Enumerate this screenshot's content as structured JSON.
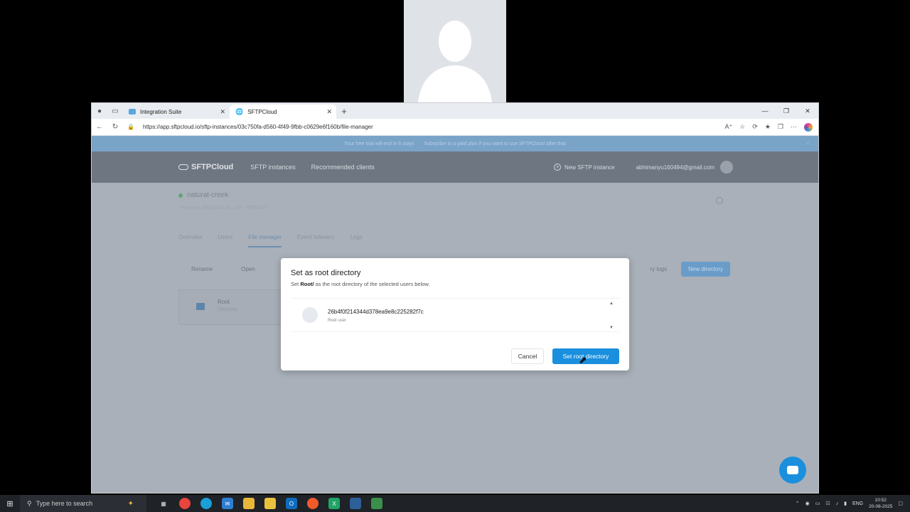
{
  "browser": {
    "tabs": [
      {
        "label": "Integration Suite",
        "active": false
      },
      {
        "label": "SFTPCloud",
        "active": true
      }
    ],
    "url": "https://app.sftpcloud.io/sftp-instances/03c750fa-d560-4f49-9fbb-c0629e6f160b/file-manager"
  },
  "banner": {
    "trial_text": "Your free trial will end in 6 stays",
    "cta_text": "Subscribe to a paid plan if you want to use SFTPCloud after that"
  },
  "nav": {
    "logo": "SFTPCloud",
    "links": [
      "SFTP instances",
      "Recommended clients"
    ],
    "new_instance": "New SFTP instance",
    "email": "abhimanyu160494@gmail.com"
  },
  "instance": {
    "name": "natural-creek",
    "meta": "eu-west.sftpcloud.io   ·   ctx   ·   STRUCT"
  },
  "subnav": [
    "Overview",
    "Users",
    "File manager",
    "Event listeners",
    "Logs"
  ],
  "toolbar": {
    "rename": "Rename",
    "open": "Open",
    "logs": "ry logs",
    "new_directory": "New directory"
  },
  "folder": {
    "name": "Root",
    "type": "Directory"
  },
  "modal": {
    "title": "Set as root directory",
    "sub_prefix": "Set ",
    "sub_path": "Root/",
    "sub_suffix": " as the root directory of the selected users below.",
    "user_id": "26b4f0f214344d378ea9e8c225282f7c",
    "user_role": "Root user",
    "cancel": "Cancel",
    "confirm": "Set root directory"
  },
  "taskbar": {
    "search_placeholder": "Type here to search",
    "lang": "ENG",
    "time": "10:52",
    "date": "20-08-2025"
  },
  "colors": {
    "primary": "#1a8fde",
    "overlay": "#a9b0b9"
  }
}
